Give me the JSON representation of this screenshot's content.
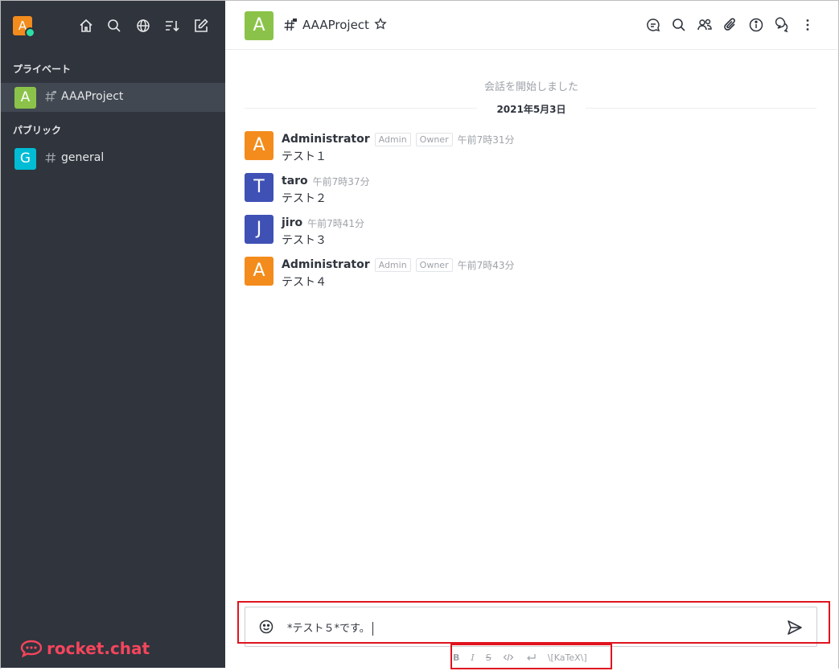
{
  "sidebar": {
    "user_avatar_letter": "A",
    "icons": [
      "home-icon",
      "search-icon",
      "directory-icon",
      "sort-icon",
      "create-new-icon"
    ],
    "sections": [
      {
        "title": "プライベート"
      },
      {
        "title": "パブリック"
      }
    ],
    "rooms": [
      {
        "letter": "A",
        "name": "AAAProject",
        "color": "#8bc34a",
        "private": true
      },
      {
        "letter": "G",
        "name": "general",
        "color": "#00bcd4",
        "private": false
      }
    ],
    "logo_text": "rocket.chat"
  },
  "room_header": {
    "avatar_letter": "A",
    "title": "AAAProject",
    "tools": [
      "discussion-icon",
      "search-icon",
      "members-icon",
      "files-icon",
      "info-icon",
      "threads-icon",
      "kebab-menu-icon"
    ]
  },
  "conversation": {
    "start_text": "会話を開始しました",
    "date_divider": "2021年5月3日",
    "messages": [
      {
        "letter": "A",
        "avatar_color": "#f38c1c",
        "user": "Administrator",
        "roles": [
          "Admin",
          "Owner"
        ],
        "time": "午前7時31分",
        "text": "テスト１"
      },
      {
        "letter": "T",
        "avatar_color": "#3f51b5",
        "user": "taro",
        "roles": [],
        "time": "午前7時37分",
        "text": "テスト２"
      },
      {
        "letter": "J",
        "avatar_color": "#3f51b5",
        "user": "jiro",
        "roles": [],
        "time": "午前7時41分",
        "text": "テスト３"
      },
      {
        "letter": "A",
        "avatar_color": "#f38c1c",
        "user": "Administrator",
        "roles": [
          "Admin",
          "Owner"
        ],
        "time": "午前7時43分",
        "text": "テスト４"
      }
    ]
  },
  "composer": {
    "value": "*テスト５*です。",
    "format_labels": {
      "bold": "B",
      "italic": "I",
      "strike": "S",
      "katex": "\\[KaTeX\\]"
    }
  },
  "colors": {
    "sidebar_bg": "#2f343d",
    "accent_red": "#e0141e",
    "brand_red": "#f5455c"
  }
}
